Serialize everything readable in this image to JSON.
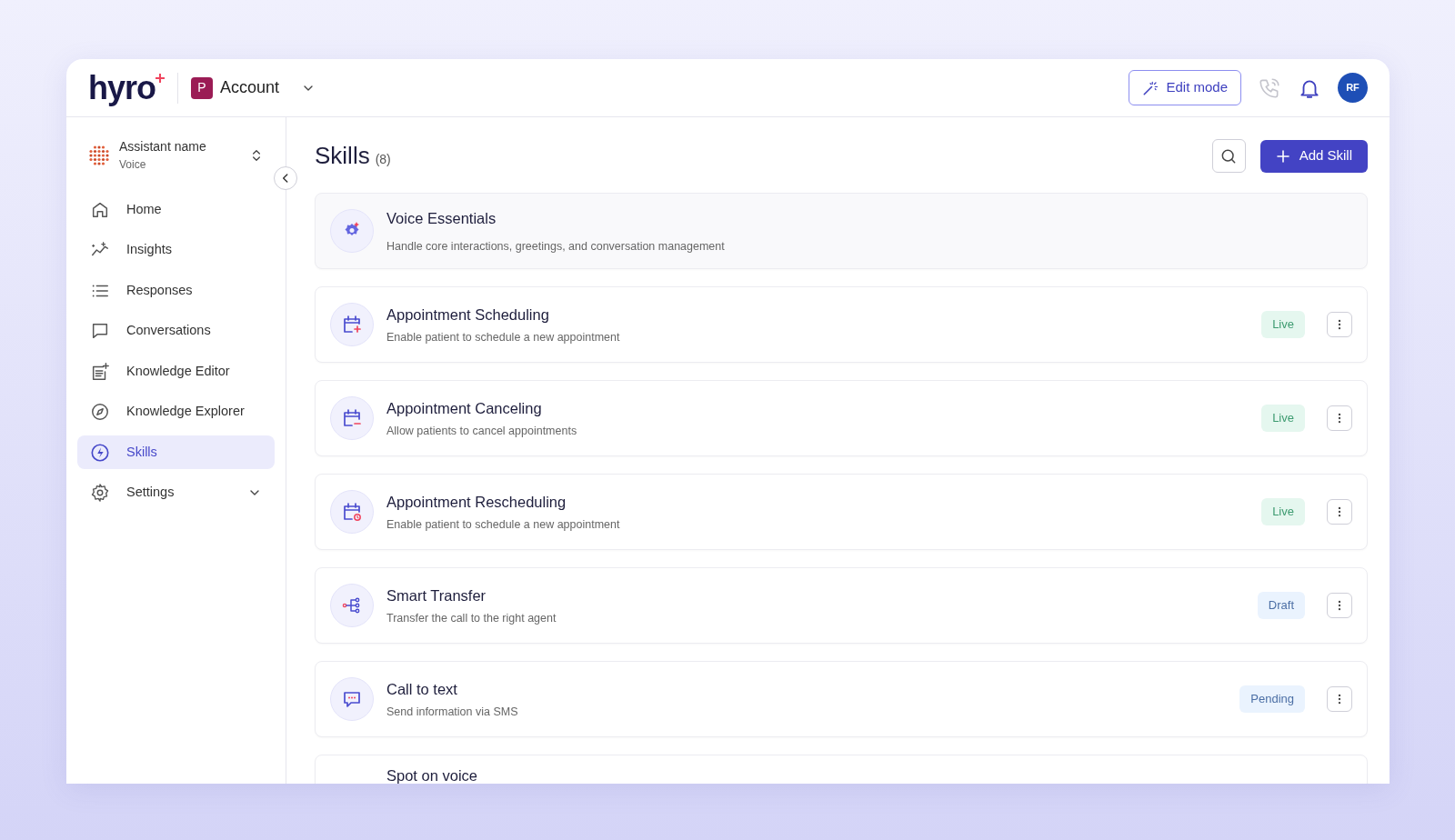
{
  "header": {
    "logo": "hyro",
    "account": {
      "initial": "P",
      "name": "Account"
    },
    "edit_button": "Edit mode",
    "avatar": "RF"
  },
  "sidebar": {
    "assistant": {
      "name": "Assistant name",
      "type": "Voice"
    },
    "items": [
      {
        "label": "Home",
        "selected": false
      },
      {
        "label": "Insights",
        "selected": false
      },
      {
        "label": "Responses",
        "selected": false
      },
      {
        "label": "Conversations",
        "selected": false
      },
      {
        "label": "Knowledge Editor",
        "selected": false
      },
      {
        "label": "Knowledge Explorer",
        "selected": false
      },
      {
        "label": "Skills",
        "selected": true
      },
      {
        "label": "Settings",
        "selected": false,
        "expandable": true
      }
    ]
  },
  "page": {
    "title": "Skills",
    "count": "(8)",
    "add_button": "Add Skill"
  },
  "skills": [
    {
      "kind": "core",
      "title": "Voice Essentials",
      "description": "Handle core interactions, greetings, and conversation management"
    },
    {
      "kind": "skill",
      "title": "Appointment Scheduling",
      "description": "Enable patient to schedule a new appointment",
      "status": "Live",
      "color": "#e5f7ef"
    },
    {
      "kind": "skill",
      "title": "Appointment Canceling",
      "description": "Allow patients to cancel appointments",
      "status": "Live",
      "color": "#e5f7ef"
    },
    {
      "kind": "skill",
      "title": "Appointment Rescheduling",
      "description": "Enable patient to schedule a new appointment",
      "status": "Live",
      "color": "#e5f7ef"
    },
    {
      "kind": "skill",
      "title": "Smart Transfer",
      "description": "Transfer the call to the right agent",
      "status": "Draft",
      "color": "#eaf3fe"
    },
    {
      "kind": "skill",
      "title": "Call to text",
      "description": "Send information via SMS",
      "status": "Pending",
      "color": "#eaf3fe"
    },
    {
      "kind": "partial",
      "title": "Spot on voice"
    }
  ]
}
